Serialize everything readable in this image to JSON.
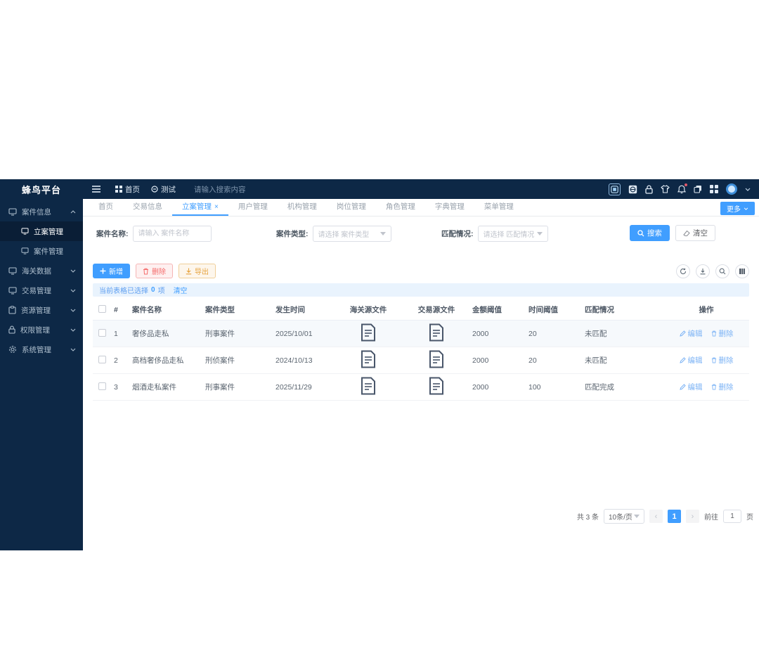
{
  "brand": {
    "name": "蜂鸟平台"
  },
  "topbar": {
    "nav_home": "首页",
    "nav_test": "测试",
    "search_placeholder": "请输入搜索内容",
    "icons": [
      "screen-icon",
      "language-icon",
      "lock-icon",
      "theme-skin-icon",
      "notification-bell-icon",
      "copy-icon",
      "apps-grid-icon",
      "user-avatar",
      "chevron-down-icon"
    ]
  },
  "sidebar": {
    "case_info": "案件信息",
    "filing_mgmt": "立案管理",
    "case_mgmt": "案件管理",
    "customs_data": "海关数据",
    "trade_mgmt": "交易管理",
    "resource_mgmt": "资源管理",
    "permission_mgmt": "权限管理",
    "system_mgmt": "系统管理"
  },
  "tabs": {
    "items": [
      "首页",
      "交易信息",
      "立案管理",
      "用户管理",
      "机构管理",
      "岗位管理",
      "角色管理",
      "字典管理",
      "菜单管理"
    ],
    "active": "立案管理",
    "close_glyph": "×",
    "more_label": "更多"
  },
  "filters": {
    "case_name_label": "案件名称:",
    "case_name_placeholder": "请输入 案件名称",
    "case_type_label": "案件类型:",
    "case_type_placeholder": "请选择 案件类型",
    "match_label": "匹配情况:",
    "match_placeholder": "请选择 匹配情况",
    "search_button": "搜索",
    "clear_button": "清空"
  },
  "toolbar": {
    "add": "新增",
    "delete": "删除",
    "export": "导出",
    "right_icons": [
      "refresh-icon",
      "download-icon",
      "search-icon",
      "columns-icon"
    ]
  },
  "selection": {
    "prefix": "当前表格已选择",
    "count": "0",
    "suffix": "项",
    "clear": "清空"
  },
  "table": {
    "columns": [
      "#",
      "案件名称",
      "案件类型",
      "发生时间",
      "海关源文件",
      "交易源文件",
      "金额阈值",
      "时间阈值",
      "匹配情况",
      "操作"
    ],
    "rows": [
      {
        "index": "1",
        "name": "奢侈品走私",
        "type": "刑事案件",
        "date": "2025/10/01",
        "amount": "2000",
        "time": "20",
        "match": "未匹配"
      },
      {
        "index": "2",
        "name": "高档奢侈品走私",
        "type": "刑侦案件",
        "date": "2024/10/13",
        "amount": "2000",
        "time": "20",
        "match": "未匹配"
      },
      {
        "index": "3",
        "name": "烟酒走私案件",
        "type": "刑事案件",
        "date": "2025/11/29",
        "amount": "2000",
        "time": "100",
        "match": "匹配完成"
      }
    ],
    "actions": {
      "edit": "编辑",
      "delete": "删除"
    }
  },
  "pagination": {
    "total": "共 3 条",
    "page_size": "10条/页",
    "prev": "‹",
    "next": "›",
    "current": "1",
    "goto_prefix": "前往",
    "goto_value": "1",
    "goto_suffix": "页"
  },
  "colors": {
    "accent": "#409eff",
    "sidebar_bg": "#0d2846",
    "danger": "#f56c6c",
    "warning": "#e6a23c",
    "selection_bg": "#e9f3fd"
  }
}
